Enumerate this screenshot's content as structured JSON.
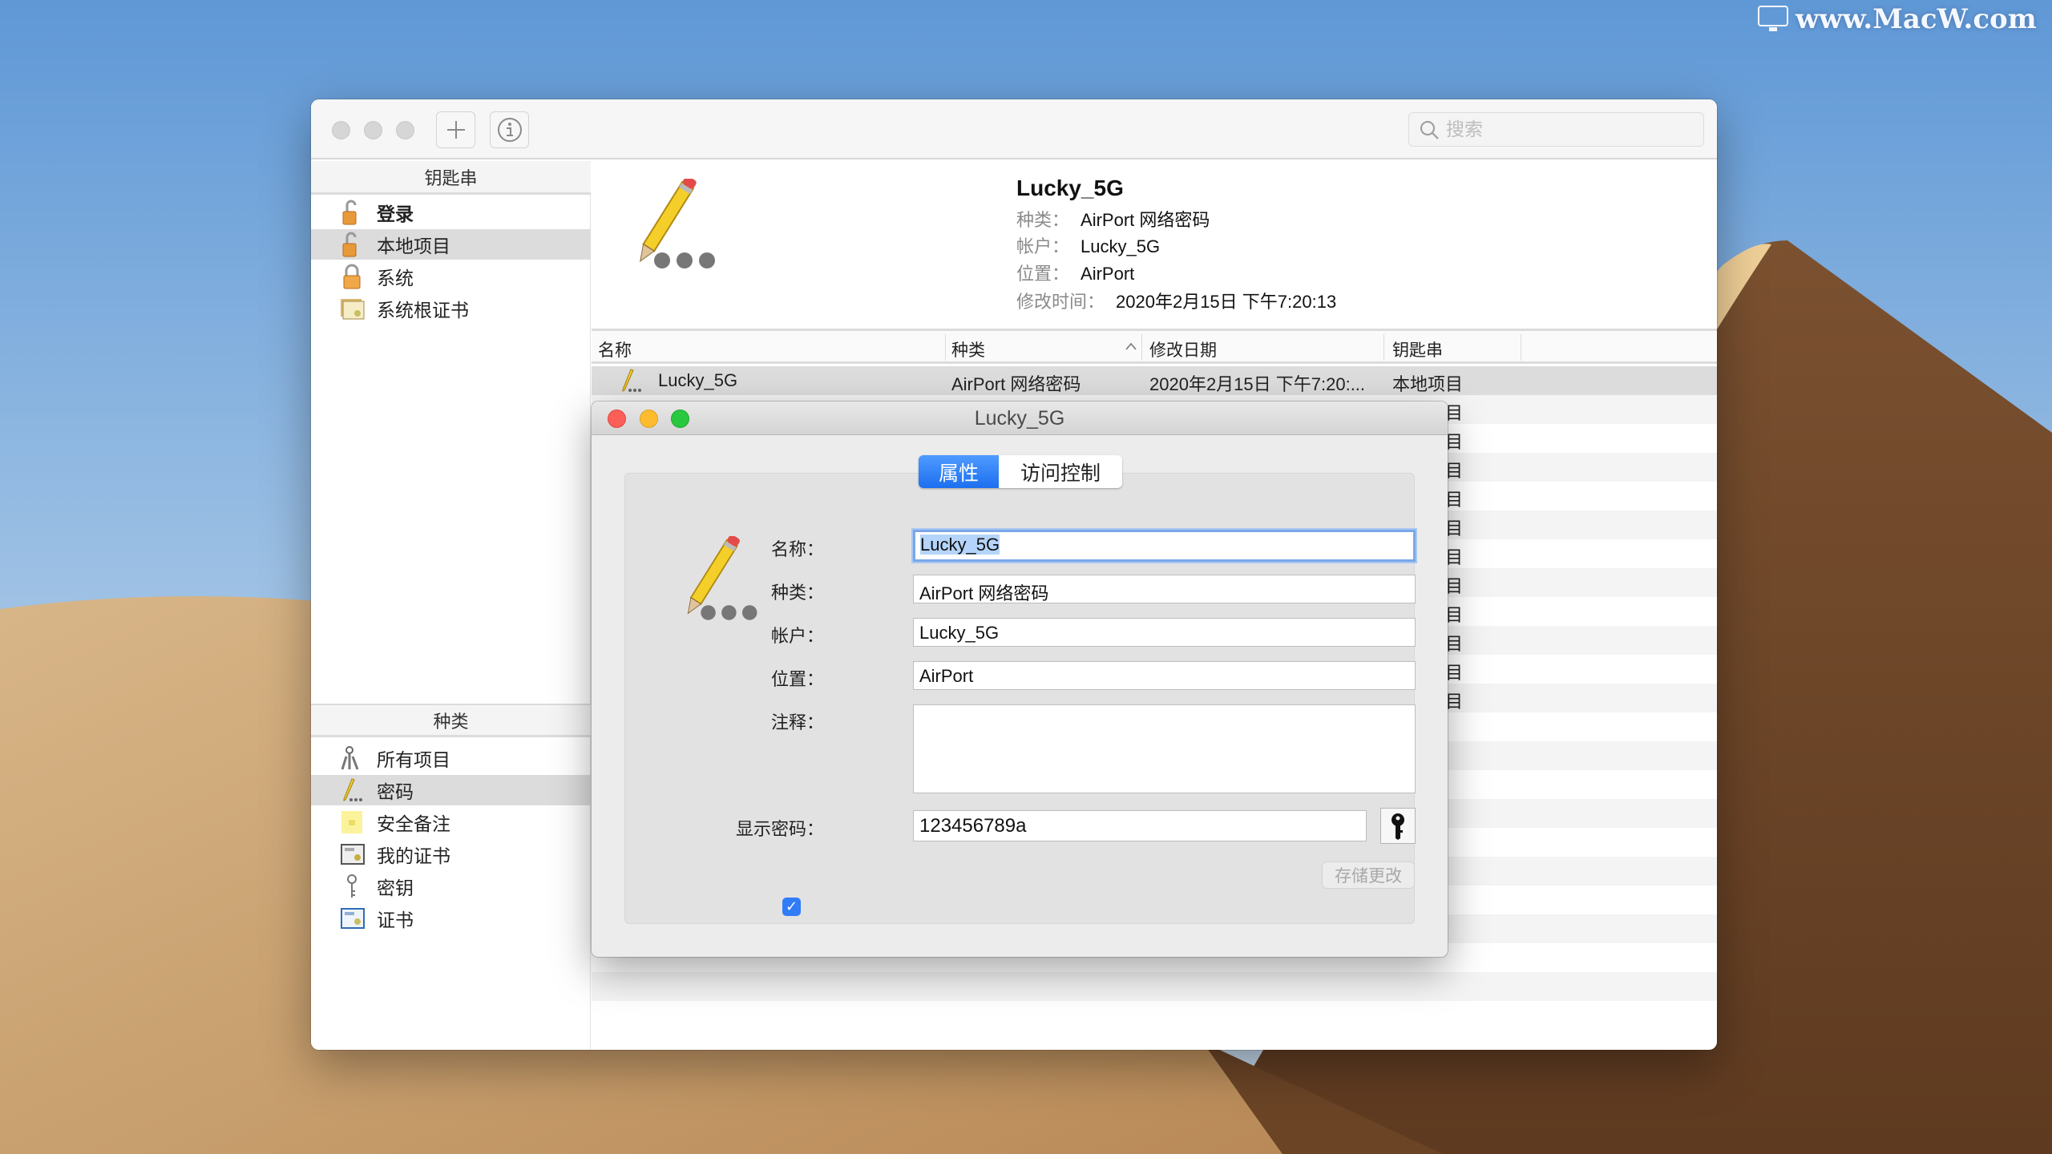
{
  "watermark": "www.MacW.com",
  "toolbar": {
    "add_icon": "plus-icon",
    "info_icon": "info-icon",
    "search_placeholder": "搜索"
  },
  "sidebar": {
    "keychains_header": "钥匙串",
    "keychains": [
      {
        "label": "登录",
        "icon": "unlocked-padlock-icon",
        "bold": true,
        "selected": false
      },
      {
        "label": "本地项目",
        "icon": "unlocked-padlock-icon",
        "selected": true
      },
      {
        "label": "系统",
        "icon": "padlock-icon",
        "selected": false
      },
      {
        "label": "系统根证书",
        "icon": "certificate-stack-icon",
        "selected": false
      }
    ],
    "categories_header": "种类",
    "categories": [
      {
        "label": "所有项目",
        "icon": "keys-icon",
        "selected": false
      },
      {
        "label": "密码",
        "icon": "pencil-password-icon",
        "selected": true
      },
      {
        "label": "安全备注",
        "icon": "secure-note-icon",
        "selected": false
      },
      {
        "label": "我的证书",
        "icon": "my-certificate-icon",
        "selected": false
      },
      {
        "label": "密钥",
        "icon": "key-icon",
        "selected": false
      },
      {
        "label": "证书",
        "icon": "certificate-icon",
        "selected": false
      }
    ]
  },
  "info": {
    "title": "Lucky_5G",
    "kind_label": "种类：",
    "kind": "AirPort 网络密码",
    "account_label": "帐户：",
    "account": "Lucky_5G",
    "where_label": "位置：",
    "where": "AirPort",
    "modified_label": "修改时间：",
    "modified": "2020年2月15日 下午7:20:13"
  },
  "table": {
    "columns": [
      "名称",
      "种类",
      "修改日期",
      "钥匙串"
    ],
    "sorted_column": "种类",
    "sort_direction": "ascending",
    "rows": [
      {
        "name": "Lucky_5G",
        "kind": "AirPort 网络密码",
        "date": "2020年2月15日 下午7:20:...",
        "keychain": "本地项目",
        "selected": true
      },
      {
        "keychain": "本地项目"
      },
      {
        "keychain": "本地项目"
      },
      {
        "keychain": "本地项目"
      },
      {
        "keychain": "本地项目"
      },
      {
        "keychain": "本地项目"
      },
      {
        "keychain": "本地项目"
      },
      {
        "keychain": "本地项目"
      },
      {
        "keychain": "本地项目"
      },
      {
        "keychain": "本地项目"
      },
      {
        "keychain": "本地项目"
      },
      {
        "keychain": "本地项目"
      }
    ]
  },
  "dialog": {
    "title": "Lucky_5G",
    "tabs": [
      {
        "label": "属性",
        "active": true
      },
      {
        "label": "访问控制",
        "active": false
      }
    ],
    "name_label": "名称：",
    "name_value": "Lucky_5G",
    "kind_label": "种类：",
    "kind_value": "AirPort 网络密码",
    "account_label": "帐户：",
    "account_value": "Lucky_5G",
    "where_label": "位置：",
    "where_value": "AirPort",
    "comments_label": "注释：",
    "comments_value": "",
    "show_password_label": "显示密码：",
    "show_password_checked": true,
    "password_value": "123456789a",
    "save_label": "存储更改",
    "save_enabled": false
  },
  "colors": {
    "accent": "#2f7cf6",
    "selection_gray": "#dcdcdc",
    "close": "#fc5f57",
    "minimize": "#fdbc2e",
    "zoom": "#28c840"
  }
}
